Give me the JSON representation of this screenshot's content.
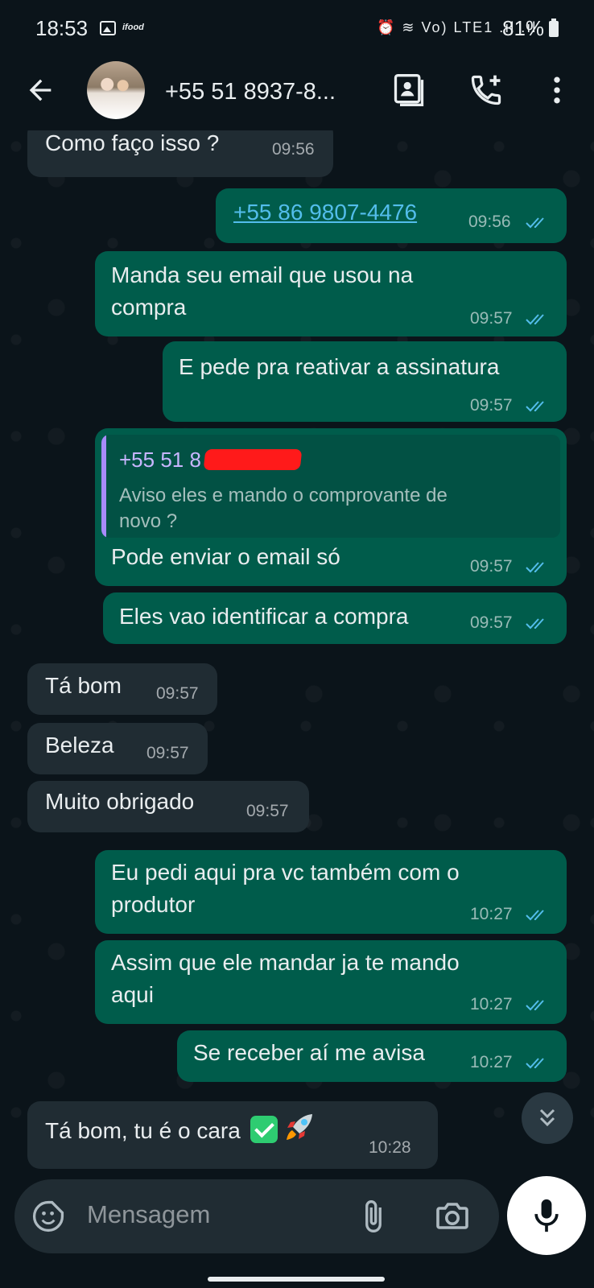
{
  "status_bar": {
    "time": "18:53",
    "ifood": "ifood",
    "network_icons": "⏰ ≋ Vo) LTE1 .ıl .ıl",
    "battery": "81%"
  },
  "header": {
    "contact_name": "+55 51 8937-8...",
    "icons": [
      "back-arrow-icon",
      "avatar",
      "contact-card-icon",
      "add-call-icon",
      "more-vert-icon"
    ]
  },
  "messages": [
    {
      "dir": "in",
      "text": "Como faço isso ?",
      "time": "09:56"
    },
    {
      "dir": "out",
      "text": "+55 86 9807-4476",
      "time": "09:56",
      "link": true
    },
    {
      "dir": "out",
      "lines": [
        "Manda seu email que usou na",
        "compra"
      ],
      "time": "09:57"
    },
    {
      "dir": "out",
      "text": "E pede pra reativar a assinatura",
      "time": "09:57"
    },
    {
      "dir": "out",
      "quote": {
        "name": "+55 51 8",
        "lines": [
          "Aviso eles e mando o comprovante de",
          "novo ?"
        ]
      },
      "text": "Pode enviar o email só",
      "time": "09:57"
    },
    {
      "dir": "out",
      "text": "Eles vao identificar a compra",
      "time": "09:57"
    },
    {
      "dir": "in",
      "text": "Tá bom",
      "time": "09:57"
    },
    {
      "dir": "in",
      "text": "Beleza",
      "time": "09:57"
    },
    {
      "dir": "in",
      "text": "Muito obrigado",
      "time": "09:57"
    },
    {
      "dir": "out",
      "lines": [
        "Eu pedi aqui pra vc também com o",
        "produtor"
      ],
      "time": "10:27"
    },
    {
      "dir": "out",
      "lines": [
        "Assim que ele mandar ja te mando",
        "aqui"
      ],
      "time": "10:27"
    },
    {
      "dir": "out",
      "text": "Se receber aí me avisa",
      "time": "10:27"
    },
    {
      "dir": "in",
      "text": "Tá bom, tu é o cara",
      "emoji": [
        "check-mark-emoji",
        "rocket-emoji"
      ],
      "time": "10:28"
    }
  ],
  "input": {
    "placeholder": "Mensagem"
  },
  "colors": {
    "background": "#0b141a",
    "incoming_bubble": "#202c33",
    "outgoing_bubble": "#005c4b",
    "read_ticks": "#53bdeb"
  }
}
